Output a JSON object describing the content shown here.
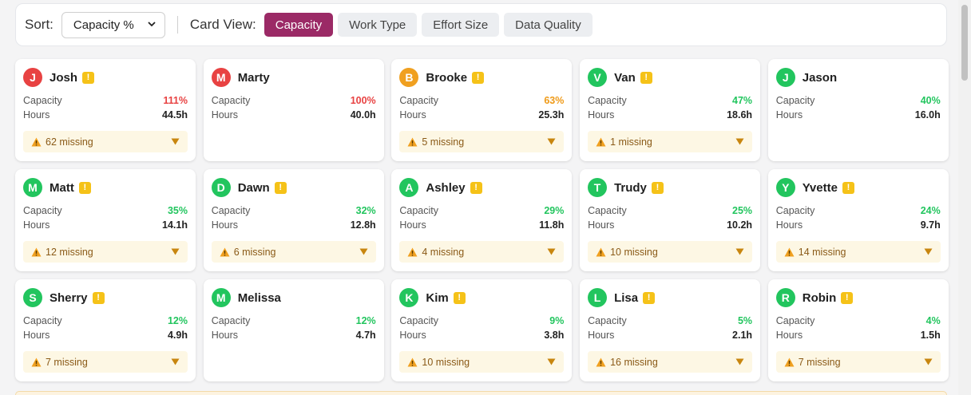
{
  "toolbar": {
    "sort_label": "Sort:",
    "sort_value": "Capacity %",
    "view_label": "Card View:",
    "views": [
      "Capacity",
      "Work Type",
      "Effort Size",
      "Data Quality"
    ],
    "active_view": "Capacity"
  },
  "card_labels": {
    "capacity": "Capacity",
    "hours": "Hours"
  },
  "colors": {
    "red": "#e84242",
    "orange": "#f0a020",
    "green": "#22c55e",
    "text_red": "#e84242",
    "text_orange": "#ef9a18",
    "text_green": "#22c55e"
  },
  "cards": [
    {
      "initial": "J",
      "name": "Josh",
      "warn": true,
      "capacity": "111%",
      "hours": "44.5h",
      "missing": "62 missing",
      "color": "red"
    },
    {
      "initial": "M",
      "name": "Marty",
      "warn": false,
      "capacity": "100%",
      "hours": "40.0h",
      "missing": "",
      "color": "red"
    },
    {
      "initial": "B",
      "name": "Brooke",
      "warn": true,
      "capacity": "63%",
      "hours": "25.3h",
      "missing": "5 missing",
      "color": "orange"
    },
    {
      "initial": "V",
      "name": "Van",
      "warn": true,
      "capacity": "47%",
      "hours": "18.6h",
      "missing": "1 missing",
      "color": "green"
    },
    {
      "initial": "J",
      "name": "Jason",
      "warn": false,
      "capacity": "40%",
      "hours": "16.0h",
      "missing": "",
      "color": "green"
    },
    {
      "initial": "M",
      "name": "Matt",
      "warn": true,
      "capacity": "35%",
      "hours": "14.1h",
      "missing": "12 missing",
      "color": "green"
    },
    {
      "initial": "D",
      "name": "Dawn",
      "warn": true,
      "capacity": "32%",
      "hours": "12.8h",
      "missing": "6 missing",
      "color": "green"
    },
    {
      "initial": "A",
      "name": "Ashley",
      "warn": true,
      "capacity": "29%",
      "hours": "11.8h",
      "missing": "4 missing",
      "color": "green"
    },
    {
      "initial": "T",
      "name": "Trudy",
      "warn": true,
      "capacity": "25%",
      "hours": "10.2h",
      "missing": "10 missing",
      "color": "green"
    },
    {
      "initial": "Y",
      "name": "Yvette",
      "warn": true,
      "capacity": "24%",
      "hours": "9.7h",
      "missing": "14 missing",
      "color": "green"
    },
    {
      "initial": "S",
      "name": "Sherry",
      "warn": true,
      "capacity": "12%",
      "hours": "4.9h",
      "missing": "7 missing",
      "color": "green"
    },
    {
      "initial": "M",
      "name": "Melissa",
      "warn": false,
      "capacity": "12%",
      "hours": "4.7h",
      "missing": "",
      "color": "green"
    },
    {
      "initial": "K",
      "name": "Kim",
      "warn": true,
      "capacity": "9%",
      "hours": "3.8h",
      "missing": "10 missing",
      "color": "green"
    },
    {
      "initial": "L",
      "name": "Lisa",
      "warn": true,
      "capacity": "5%",
      "hours": "2.1h",
      "missing": "16 missing",
      "color": "green"
    },
    {
      "initial": "R",
      "name": "Robin",
      "warn": true,
      "capacity": "4%",
      "hours": "1.5h",
      "missing": "7 missing",
      "color": "green"
    }
  ]
}
